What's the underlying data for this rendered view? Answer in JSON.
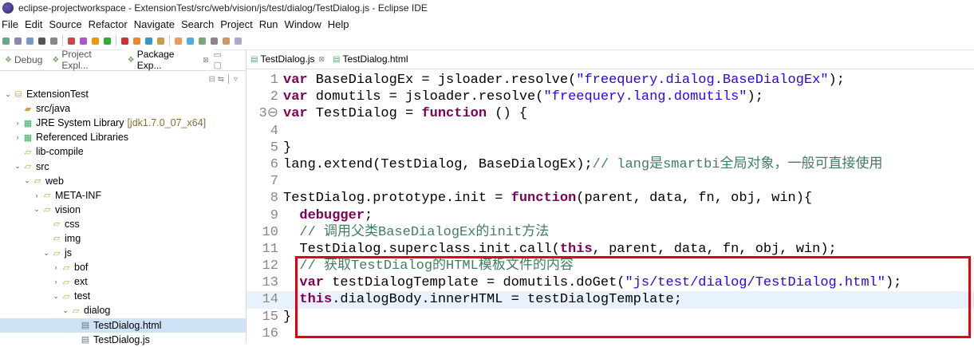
{
  "window": {
    "title": "eclipse-projectworkspace - ExtensionTest/src/web/vision/js/test/dialog/TestDialog.js - Eclipse IDE"
  },
  "menu": [
    "File",
    "Edit",
    "Source",
    "Refactor",
    "Navigate",
    "Search",
    "Project",
    "Run",
    "Window",
    "Help"
  ],
  "left_tabs": [
    {
      "label": "Debug",
      "icon": "debug-icon"
    },
    {
      "label": "Project Expl...",
      "icon": "project-explorer-icon"
    },
    {
      "label": "Package Exp...",
      "icon": "package-explorer-icon",
      "active": true,
      "close": "⊠"
    }
  ],
  "tree": [
    {
      "depth": 0,
      "arrow": "⌄",
      "icon": "project-icon",
      "label": "ExtensionTest"
    },
    {
      "depth": 1,
      "arrow": "",
      "icon": "source-folder-icon",
      "label": "src/java"
    },
    {
      "depth": 1,
      "arrow": "›",
      "icon": "library-icon",
      "label": "JRE System Library",
      "suffix": "[jdk1.7.0_07_x64]"
    },
    {
      "depth": 1,
      "arrow": "›",
      "icon": "library-icon",
      "label": "Referenced Libraries"
    },
    {
      "depth": 1,
      "arrow": "",
      "icon": "folder-icon",
      "label": "lib-compile"
    },
    {
      "depth": 1,
      "arrow": "⌄",
      "icon": "folder-icon",
      "label": "src"
    },
    {
      "depth": 2,
      "arrow": "⌄",
      "icon": "folder-icon",
      "label": "web"
    },
    {
      "depth": 3,
      "arrow": "›",
      "icon": "folder-icon",
      "label": "META-INF"
    },
    {
      "depth": 3,
      "arrow": "⌄",
      "icon": "folder-icon",
      "label": "vision"
    },
    {
      "depth": 4,
      "arrow": "",
      "icon": "folder-icon",
      "label": "css"
    },
    {
      "depth": 4,
      "arrow": "",
      "icon": "folder-icon",
      "label": "img"
    },
    {
      "depth": 4,
      "arrow": "⌄",
      "icon": "folder-icon",
      "label": "js"
    },
    {
      "depth": 5,
      "arrow": "›",
      "icon": "folder-icon",
      "label": "bof"
    },
    {
      "depth": 5,
      "arrow": "›",
      "icon": "folder-icon",
      "label": "ext"
    },
    {
      "depth": 5,
      "arrow": "⌄",
      "icon": "folder-icon",
      "label": "test"
    },
    {
      "depth": 6,
      "arrow": "⌄",
      "icon": "folder-icon",
      "label": "dialog"
    },
    {
      "depth": 7,
      "arrow": "",
      "icon": "html-file-icon",
      "label": "TestDialog.html",
      "selected": true
    },
    {
      "depth": 7,
      "arrow": "",
      "icon": "js-file-icon",
      "label": "TestDialog.js"
    }
  ],
  "editor_tabs": [
    {
      "label": "TestDialog.js",
      "icon": "js-file-icon",
      "close": "⊠",
      "active": true
    },
    {
      "label": "TestDialog.html",
      "icon": "html-file-icon"
    }
  ],
  "code": [
    {
      "n": "1",
      "parts": [
        [
          "kw",
          "var"
        ],
        [
          "t",
          " BaseDialogEx = jsloader.resolve("
        ],
        [
          "str",
          "\"freequery.dialog.BaseDialogEx\""
        ],
        [
          "t",
          ");"
        ]
      ]
    },
    {
      "n": "2",
      "parts": [
        [
          "kw",
          "var"
        ],
        [
          "t",
          " domutils = jsloader.resolve("
        ],
        [
          "str",
          "\"freequery.lang.domutils\""
        ],
        [
          "t",
          ");"
        ]
      ]
    },
    {
      "n": "3⊖",
      "parts": [
        [
          "kw",
          "var"
        ],
        [
          "t",
          " TestDialog = "
        ],
        [
          "kw",
          "function"
        ],
        [
          "t",
          " () {"
        ]
      ]
    },
    {
      "n": "4",
      "parts": [
        [
          "t",
          ""
        ]
      ]
    },
    {
      "n": "5",
      "parts": [
        [
          "t",
          "}"
        ]
      ]
    },
    {
      "n": "6",
      "parts": [
        [
          "t",
          "lang.extend(TestDialog, BaseDialogEx);"
        ],
        [
          "cm",
          "// lang是smartbi全局对象，一般可直接使用"
        ]
      ]
    },
    {
      "n": "7",
      "parts": [
        [
          "t",
          ""
        ]
      ]
    },
    {
      "n": "8",
      "parts": [
        [
          "t",
          "TestDialog.prototype.init = "
        ],
        [
          "kw",
          "function"
        ],
        [
          "t",
          "(parent, data, fn, obj, win){"
        ]
      ]
    },
    {
      "n": "9",
      "parts": [
        [
          "t",
          "  "
        ],
        [
          "kw",
          "debugger"
        ],
        [
          "t",
          ";"
        ]
      ]
    },
    {
      "n": "10",
      "parts": [
        [
          "t",
          "  "
        ],
        [
          "cm",
          "// 调用父类BaseDialogEx的init方法"
        ]
      ]
    },
    {
      "n": "11",
      "parts": [
        [
          "t",
          "  TestDialog.superclass.init.call("
        ],
        [
          "kw",
          "this"
        ],
        [
          "t",
          ", parent, data, fn, obj, win);"
        ]
      ]
    },
    {
      "n": "12",
      "parts": [
        [
          "t",
          "  "
        ],
        [
          "cm",
          "// 获取TestDialog的HTML模板文件的内容"
        ]
      ]
    },
    {
      "n": "13",
      "parts": [
        [
          "t",
          "  "
        ],
        [
          "kw",
          "var"
        ],
        [
          "t",
          " testDialogTemplate = domutils.doGet("
        ],
        [
          "str",
          "\"js/test/dialog/TestDialog.html\""
        ],
        [
          "t",
          ");"
        ]
      ]
    },
    {
      "n": "14",
      "current": true,
      "parts": [
        [
          "t",
          "  "
        ],
        [
          "kw",
          "this"
        ],
        [
          "t",
          ".dialogBody.innerHTML = testDialogTemplate;"
        ]
      ]
    },
    {
      "n": "15",
      "parts": [
        [
          "t",
          "}"
        ]
      ]
    },
    {
      "n": "16",
      "parts": [
        [
          "t",
          ""
        ]
      ]
    }
  ],
  "colors": {
    "keyword": "#7f0055",
    "string": "#2a00ff",
    "comment": "#3f7f5f",
    "highlight_box": "#e8000b",
    "selection": "#cfe3f7"
  }
}
